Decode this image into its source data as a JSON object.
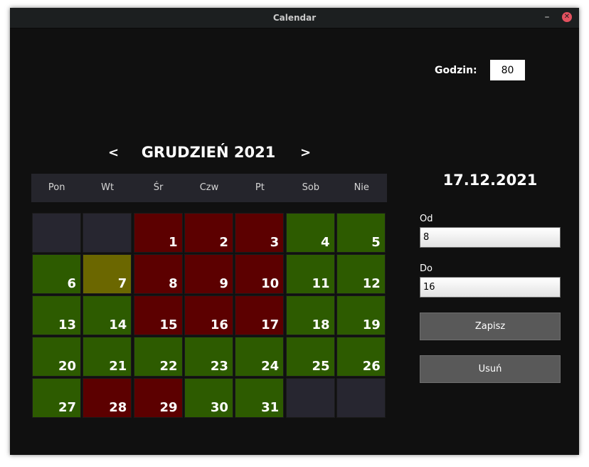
{
  "window": {
    "title": "Calendar",
    "minimize_glyph": "–",
    "close_glyph": "✕"
  },
  "hours": {
    "label": "Godzin:",
    "value": "80"
  },
  "calendar": {
    "prev": "<",
    "next": ">",
    "month_title": "GRUDZIEŃ 2021",
    "weekdays": [
      "Pon",
      "Wt",
      "Śr",
      "Czw",
      "Pt",
      "Sob",
      "Nie"
    ],
    "days": [
      {
        "n": "",
        "status": "empty"
      },
      {
        "n": "",
        "status": "empty"
      },
      {
        "n": "1",
        "status": "red"
      },
      {
        "n": "2",
        "status": "red"
      },
      {
        "n": "3",
        "status": "red"
      },
      {
        "n": "4",
        "status": "green"
      },
      {
        "n": "5",
        "status": "green"
      },
      {
        "n": "6",
        "status": "green"
      },
      {
        "n": "7",
        "status": "yellow"
      },
      {
        "n": "8",
        "status": "red"
      },
      {
        "n": "9",
        "status": "red"
      },
      {
        "n": "10",
        "status": "red"
      },
      {
        "n": "11",
        "status": "green"
      },
      {
        "n": "12",
        "status": "green"
      },
      {
        "n": "13",
        "status": "green"
      },
      {
        "n": "14",
        "status": "green"
      },
      {
        "n": "15",
        "status": "red"
      },
      {
        "n": "16",
        "status": "red"
      },
      {
        "n": "17",
        "status": "red"
      },
      {
        "n": "18",
        "status": "green"
      },
      {
        "n": "19",
        "status": "green"
      },
      {
        "n": "20",
        "status": "green"
      },
      {
        "n": "21",
        "status": "green"
      },
      {
        "n": "22",
        "status": "green"
      },
      {
        "n": "23",
        "status": "green"
      },
      {
        "n": "24",
        "status": "green"
      },
      {
        "n": "25",
        "status": "green"
      },
      {
        "n": "26",
        "status": "green"
      },
      {
        "n": "27",
        "status": "green"
      },
      {
        "n": "28",
        "status": "red"
      },
      {
        "n": "29",
        "status": "red"
      },
      {
        "n": "30",
        "status": "green"
      },
      {
        "n": "31",
        "status": "green"
      },
      {
        "n": "",
        "status": "empty"
      },
      {
        "n": "",
        "status": "empty"
      }
    ]
  },
  "detail": {
    "selected_date": "17.12.2021",
    "from_label": "Od",
    "from_value": "8",
    "to_label": "Do",
    "to_value": "16",
    "save_label": "Zapisz",
    "delete_label": "Usuń"
  },
  "colors": {
    "red": "#5c0000",
    "green": "#2d5b00",
    "yellow": "#6b6700",
    "empty": "#272630"
  }
}
